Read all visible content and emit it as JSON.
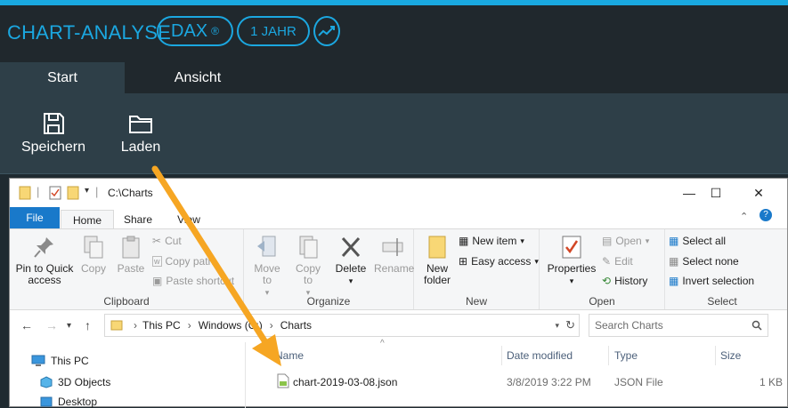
{
  "app": {
    "title": "CHART-ANALYSE",
    "index_pill": "DAX",
    "index_reg": "®",
    "period_pill": "1 JAHR",
    "trend_icon": "trend-chart-icon",
    "accent_color": "#1ba7e0",
    "tabs": [
      {
        "label": "Start",
        "active": true
      },
      {
        "label": "Ansicht",
        "active": false
      }
    ],
    "ribbon_buttons": [
      {
        "label": "Speichern",
        "icon": "save-icon"
      },
      {
        "label": "Laden",
        "icon": "folder-open-icon"
      }
    ]
  },
  "explorer": {
    "title_path": "C:\\Charts",
    "window_buttons": [
      "—",
      "☐",
      "✕"
    ],
    "menu_tabs": [
      "File",
      "Home",
      "Share",
      "View"
    ],
    "groups": {
      "clipboard": {
        "label": "Clipboard",
        "pin": "Pin to Quick access",
        "copy": "Copy",
        "paste": "Paste",
        "cut": "Cut",
        "copy_path": "Copy path",
        "paste_shortcut": "Paste shortcut"
      },
      "organize": {
        "label": "Organize",
        "move_to": "Move to",
        "copy_to": "Copy to",
        "delete": "Delete",
        "rename": "Rename"
      },
      "new": {
        "label": "New",
        "new_folder": "New folder",
        "new_item": "New item",
        "easy_access": "Easy access"
      },
      "open": {
        "label": "Open",
        "properties": "Properties",
        "open": "Open",
        "edit": "Edit",
        "history": "History"
      },
      "select": {
        "label": "Select",
        "select_all": "Select all",
        "select_none": "Select none",
        "invert": "Invert selection"
      }
    },
    "address": {
      "crumbs": [
        "This PC",
        "Windows (C:)",
        "Charts"
      ],
      "search_placeholder": "Search Charts"
    },
    "nav_items": [
      "This PC",
      "3D Objects",
      "Desktop"
    ],
    "columns": [
      "Name",
      "Date modified",
      "Type",
      "Size"
    ],
    "files": [
      {
        "name": "chart-2019-03-08.json",
        "date": "3/8/2019 3:22 PM",
        "type": "JSON File",
        "size": "1 KB"
      }
    ]
  }
}
